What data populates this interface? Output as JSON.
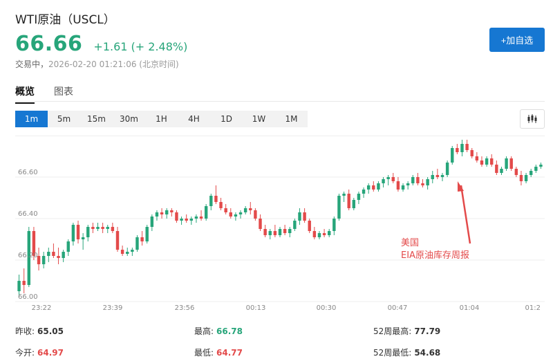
{
  "header": {
    "title": "WTI原油（USCL）",
    "price": "66.66",
    "change": "+1.61 (+ 2.48%)",
    "status": "交易中，",
    "datetime": "2026-02-20 01:21:06",
    "timezone": "(北京时间)",
    "add_watchlist_label": "+加自选"
  },
  "tabs": [
    {
      "label": "概览",
      "active": true
    },
    {
      "label": "图表",
      "active": false
    }
  ],
  "periods": [
    {
      "label": "1m",
      "active": true
    },
    {
      "label": "5m",
      "active": false
    },
    {
      "label": "15m",
      "active": false
    },
    {
      "label": "30m",
      "active": false
    },
    {
      "label": "1H",
      "active": false
    },
    {
      "label": "4H",
      "active": false
    },
    {
      "label": "1D",
      "active": false
    },
    {
      "label": "1W",
      "active": false
    },
    {
      "label": "1M",
      "active": false
    }
  ],
  "chart_type_icon": "candlestick-icon",
  "colors": {
    "up": "#27a57a",
    "down": "#e34a4a",
    "accent": "#1677d2",
    "annotation": "#e34a4a"
  },
  "chart_data": {
    "type": "candlestick",
    "title": "",
    "xlabel": "",
    "ylabel": "",
    "ylim": [
      66.0,
      66.8
    ],
    "y_ticks": [
      "66.00",
      "66.20",
      "66.40",
      "66.60"
    ],
    "x_ticks": [
      "23:22",
      "23:39",
      "23:56",
      "00:13",
      "00:30",
      "00:47",
      "01:04",
      "01:2"
    ],
    "grid": true,
    "annotation": {
      "line1": "美国",
      "line2": "EIA原油库存周报"
    },
    "candles": [
      [
        66.05,
        66.13,
        66.02,
        66.1
      ],
      [
        66.1,
        66.16,
        66.04,
        66.08
      ],
      [
        66.08,
        66.36,
        66.07,
        66.34
      ],
      [
        66.34,
        66.36,
        66.2,
        66.22
      ],
      [
        66.22,
        66.26,
        66.15,
        66.18
      ],
      [
        66.18,
        66.24,
        66.16,
        66.22
      ],
      [
        66.22,
        66.26,
        66.19,
        66.24
      ],
      [
        66.24,
        66.28,
        66.21,
        66.22
      ],
      [
        66.22,
        66.26,
        66.18,
        66.21
      ],
      [
        66.21,
        66.25,
        66.19,
        66.24
      ],
      [
        66.24,
        66.3,
        66.22,
        66.29
      ],
      [
        66.29,
        66.38,
        66.27,
        66.37
      ],
      [
        66.37,
        66.39,
        66.28,
        66.3
      ],
      [
        66.3,
        66.33,
        66.25,
        66.31
      ],
      [
        66.31,
        66.37,
        66.29,
        66.36
      ],
      [
        66.36,
        66.38,
        66.33,
        66.35
      ],
      [
        66.35,
        66.38,
        66.34,
        66.36
      ],
      [
        66.36,
        66.38,
        66.33,
        66.35
      ],
      [
        66.35,
        66.37,
        66.33,
        66.36
      ],
      [
        66.36,
        66.38,
        66.33,
        66.34
      ],
      [
        66.34,
        66.36,
        66.24,
        66.25
      ],
      [
        66.25,
        66.27,
        66.22,
        66.23
      ],
      [
        66.23,
        66.26,
        66.22,
        66.24
      ],
      [
        66.24,
        66.26,
        66.22,
        66.25
      ],
      [
        66.25,
        66.32,
        66.24,
        66.31
      ],
      [
        66.31,
        66.34,
        66.27,
        66.29
      ],
      [
        66.29,
        66.37,
        66.28,
        66.36
      ],
      [
        66.36,
        66.42,
        66.34,
        66.41
      ],
      [
        66.41,
        66.44,
        66.39,
        66.43
      ],
      [
        66.43,
        66.45,
        66.4,
        66.42
      ],
      [
        66.42,
        66.45,
        66.4,
        66.44
      ],
      [
        66.44,
        66.45,
        66.41,
        66.43
      ],
      [
        66.43,
        66.44,
        66.38,
        66.39
      ],
      [
        66.39,
        66.41,
        66.37,
        66.4
      ],
      [
        66.4,
        66.42,
        66.38,
        66.39
      ],
      [
        66.39,
        66.41,
        66.37,
        66.4
      ],
      [
        66.4,
        66.42,
        66.38,
        66.41
      ],
      [
        66.41,
        66.44,
        66.39,
        66.4
      ],
      [
        66.4,
        66.47,
        66.39,
        66.46
      ],
      [
        66.46,
        66.52,
        66.44,
        66.51
      ],
      [
        66.51,
        66.56,
        66.47,
        66.48
      ],
      [
        66.48,
        66.5,
        66.44,
        66.45
      ],
      [
        66.45,
        66.47,
        66.42,
        66.43
      ],
      [
        66.43,
        66.45,
        66.4,
        66.41
      ],
      [
        66.41,
        66.43,
        66.39,
        66.42
      ],
      [
        66.42,
        66.44,
        66.4,
        66.43
      ],
      [
        66.43,
        66.46,
        66.42,
        66.45
      ],
      [
        66.45,
        66.48,
        66.42,
        66.44
      ],
      [
        66.44,
        66.45,
        66.39,
        66.4
      ],
      [
        66.4,
        66.42,
        66.34,
        66.35
      ],
      [
        66.35,
        66.37,
        66.31,
        66.32
      ],
      [
        66.32,
        66.35,
        66.3,
        66.34
      ],
      [
        66.34,
        66.37,
        66.31,
        66.32
      ],
      [
        66.32,
        66.36,
        66.31,
        66.35
      ],
      [
        66.35,
        66.37,
        66.32,
        66.33
      ],
      [
        66.33,
        66.36,
        66.31,
        66.35
      ],
      [
        66.35,
        66.4,
        66.34,
        66.39
      ],
      [
        66.39,
        66.45,
        66.37,
        66.43
      ],
      [
        66.43,
        66.45,
        66.38,
        66.39
      ],
      [
        66.39,
        66.4,
        66.33,
        66.34
      ],
      [
        66.34,
        66.36,
        66.3,
        66.31
      ],
      [
        66.31,
        66.34,
        66.3,
        66.33
      ],
      [
        66.33,
        66.35,
        66.31,
        66.32
      ],
      [
        66.32,
        66.35,
        66.31,
        66.34
      ],
      [
        66.34,
        66.41,
        66.32,
        66.4
      ],
      [
        66.4,
        66.52,
        66.39,
        66.51
      ],
      [
        66.51,
        66.53,
        66.48,
        66.52
      ],
      [
        66.52,
        66.54,
        66.44,
        66.45
      ],
      [
        66.45,
        66.5,
        66.44,
        66.49
      ],
      [
        66.49,
        66.53,
        66.47,
        66.52
      ],
      [
        66.52,
        66.55,
        66.5,
        66.54
      ],
      [
        66.54,
        66.57,
        66.52,
        66.56
      ],
      [
        66.56,
        66.58,
        66.53,
        66.54
      ],
      [
        66.54,
        66.58,
        66.53,
        66.57
      ],
      [
        66.57,
        66.6,
        66.55,
        66.59
      ],
      [
        66.59,
        66.61,
        66.56,
        66.6
      ],
      [
        66.6,
        66.62,
        66.57,
        66.58
      ],
      [
        66.58,
        66.6,
        66.53,
        66.54
      ],
      [
        66.54,
        66.57,
        66.53,
        66.56
      ],
      [
        66.56,
        66.58,
        66.54,
        66.57
      ],
      [
        66.57,
        66.61,
        66.56,
        66.6
      ],
      [
        66.6,
        66.62,
        66.56,
        66.57
      ],
      [
        66.57,
        66.59,
        66.55,
        66.56
      ],
      [
        66.56,
        66.6,
        66.54,
        66.59
      ],
      [
        66.59,
        66.63,
        66.57,
        66.61
      ],
      [
        66.61,
        66.64,
        66.59,
        66.6
      ],
      [
        66.6,
        66.62,
        66.58,
        66.61
      ],
      [
        66.61,
        66.68,
        66.6,
        66.67
      ],
      [
        66.67,
        66.75,
        66.66,
        66.74
      ],
      [
        66.74,
        66.76,
        66.71,
        66.72
      ],
      [
        66.72,
        66.78,
        66.7,
        66.76
      ],
      [
        66.76,
        66.78,
        66.72,
        66.73
      ],
      [
        66.73,
        66.74,
        66.69,
        66.7
      ],
      [
        66.7,
        66.72,
        66.67,
        66.68
      ],
      [
        66.68,
        66.7,
        66.65,
        66.66
      ],
      [
        66.66,
        66.7,
        66.65,
        66.69
      ],
      [
        66.69,
        66.71,
        66.65,
        66.66
      ],
      [
        66.66,
        66.68,
        66.61,
        66.62
      ],
      [
        66.62,
        66.65,
        66.61,
        66.64
      ],
      [
        66.64,
        66.7,
        66.63,
        66.69
      ],
      [
        66.69,
        66.7,
        66.63,
        66.64
      ],
      [
        66.64,
        66.65,
        66.6,
        66.61
      ],
      [
        66.61,
        66.63,
        66.56,
        66.58
      ],
      [
        66.58,
        66.62,
        66.57,
        66.61
      ],
      [
        66.61,
        66.64,
        66.6,
        66.63
      ],
      [
        66.63,
        66.66,
        66.62,
        66.65
      ],
      [
        66.65,
        66.67,
        66.64,
        66.66
      ]
    ]
  },
  "stats": [
    {
      "label": "昨收:",
      "value": "65.05",
      "color": "plain"
    },
    {
      "label": "最高:",
      "value": "66.78",
      "color": "green"
    },
    {
      "label": "52周最高:",
      "value": "77.79",
      "color": "plain"
    },
    {
      "label": "今开:",
      "value": "64.97",
      "color": "red"
    },
    {
      "label": "最低:",
      "value": "64.77",
      "color": "red"
    },
    {
      "label": "52周最低:",
      "value": "54.68",
      "color": "plain"
    }
  ]
}
